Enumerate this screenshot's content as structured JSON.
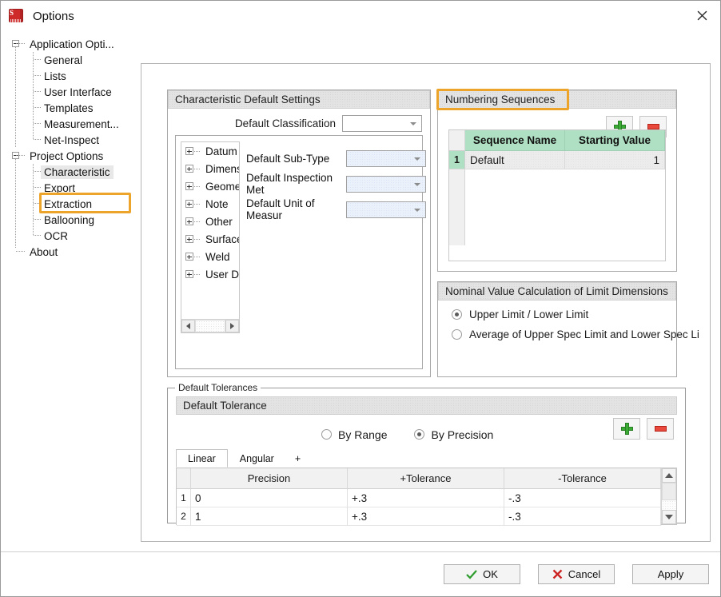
{
  "window": {
    "title": "Options",
    "app_icon": "solidworks-cube-icon",
    "close_icon": "close-icon"
  },
  "sidebar": {
    "nodes": [
      {
        "label": "Application Opti...",
        "level": 0,
        "expander": "minus"
      },
      {
        "label": "General",
        "level": 1
      },
      {
        "label": "Lists",
        "level": 1
      },
      {
        "label": "User Interface",
        "level": 1
      },
      {
        "label": "Templates",
        "level": 1
      },
      {
        "label": "Measurement...",
        "level": 1
      },
      {
        "label": "Net-Inspect",
        "level": 1
      },
      {
        "label": "Project Options",
        "level": 0,
        "expander": "minus"
      },
      {
        "label": "Characteristic",
        "level": 1,
        "selected": true,
        "highlighted": true
      },
      {
        "label": "Export",
        "level": 1
      },
      {
        "label": "Extraction",
        "level": 1
      },
      {
        "label": "Ballooning",
        "level": 1
      },
      {
        "label": "OCR",
        "level": 1
      },
      {
        "label": "About",
        "level": 0
      }
    ],
    "highlight_color": "#eda42b"
  },
  "characteristic_panel": {
    "header": "Characteristic Default Settings",
    "classification_label": "Default Classification",
    "classification_value": "",
    "tree_items": [
      "Datum",
      "Dimens",
      "Geome",
      "Note",
      "Other",
      "Surface",
      "Weld",
      "User D"
    ],
    "fields": [
      {
        "label": "Default Sub-Type",
        "value": ""
      },
      {
        "label": "Default Inspection Met",
        "value": ""
      },
      {
        "label": "Default Unit of Measur",
        "value": ""
      }
    ]
  },
  "numbering_panel": {
    "header": "Numbering Sequences",
    "highlighted": true,
    "add_icon": "plus-icon",
    "remove_icon": "minus-icon",
    "columns": [
      "Sequence Name",
      "Starting Value"
    ],
    "rows": [
      {
        "num": "1",
        "name": "Default",
        "start": "1"
      }
    ],
    "header_color": "#b0e0c3"
  },
  "nominal_panel": {
    "header": "Nominal Value Calculation of Limit Dimensions",
    "options": [
      {
        "label": "Upper Limit / Lower Limit",
        "selected": true
      },
      {
        "label": "Average of Upper Spec Limit and Lower Spec Li",
        "selected": false
      }
    ]
  },
  "tolerances": {
    "legend": "Default Tolerances",
    "header": "Default Tolerance",
    "mode_options": [
      {
        "label": "By Range",
        "selected": false
      },
      {
        "label": "By Precision",
        "selected": true
      }
    ],
    "add_icon": "plus-icon",
    "remove_icon": "minus-icon",
    "tabs": [
      {
        "label": "Linear",
        "active": true
      },
      {
        "label": "Angular",
        "active": false
      },
      {
        "label": "+",
        "active": false
      }
    ],
    "columns": [
      "Precision",
      "+Tolerance",
      "-Tolerance"
    ],
    "rows": [
      {
        "num": "1",
        "precision": "0",
        "plus": "+.3",
        "minus": "-.3"
      },
      {
        "num": "2",
        "precision": "1",
        "plus": "+.3",
        "minus": "-.3"
      }
    ],
    "scroll_up_icon": "scroll-up-icon",
    "scroll_down_icon": "scroll-down-icon"
  },
  "footer": {
    "ok": "OK",
    "cancel": "Cancel",
    "apply": "Apply",
    "ok_icon": "check-icon",
    "cancel_icon": "x-icon"
  }
}
